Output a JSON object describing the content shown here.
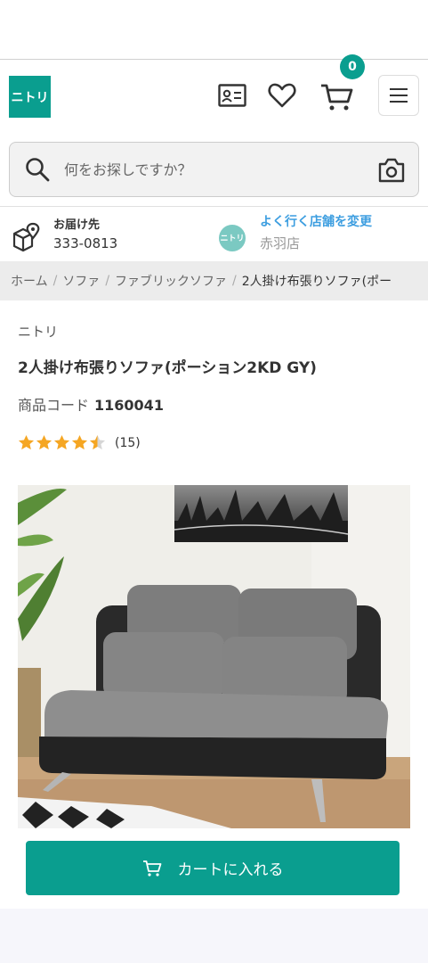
{
  "header": {
    "logo_text": "ニトリ",
    "cart_count": "0"
  },
  "search": {
    "placeholder": "何をお探しですか？"
  },
  "delivery": {
    "label": "お届け先",
    "postcode": "333-0813"
  },
  "store": {
    "logo_text": "ニトリ",
    "link": "よく行く店舗を変更",
    "name": "赤羽店"
  },
  "breadcrumb": {
    "items": [
      "ホーム",
      "ソファ",
      "ファブリックソファ"
    ],
    "current": "2人掛け布張りソファ(ポー"
  },
  "product": {
    "brand": "ニトリ",
    "title": "2人掛け布張りソファ(ポーション2KD GY)",
    "code_label": "商品コード",
    "code": "1160041",
    "rating": 4.5,
    "review_count": "(15)"
  },
  "cart_button": {
    "label": "カートに入れる"
  },
  "colors": {
    "brand": "#0a9e8f",
    "link": "#3d9ee0",
    "star": "#f5a623"
  }
}
